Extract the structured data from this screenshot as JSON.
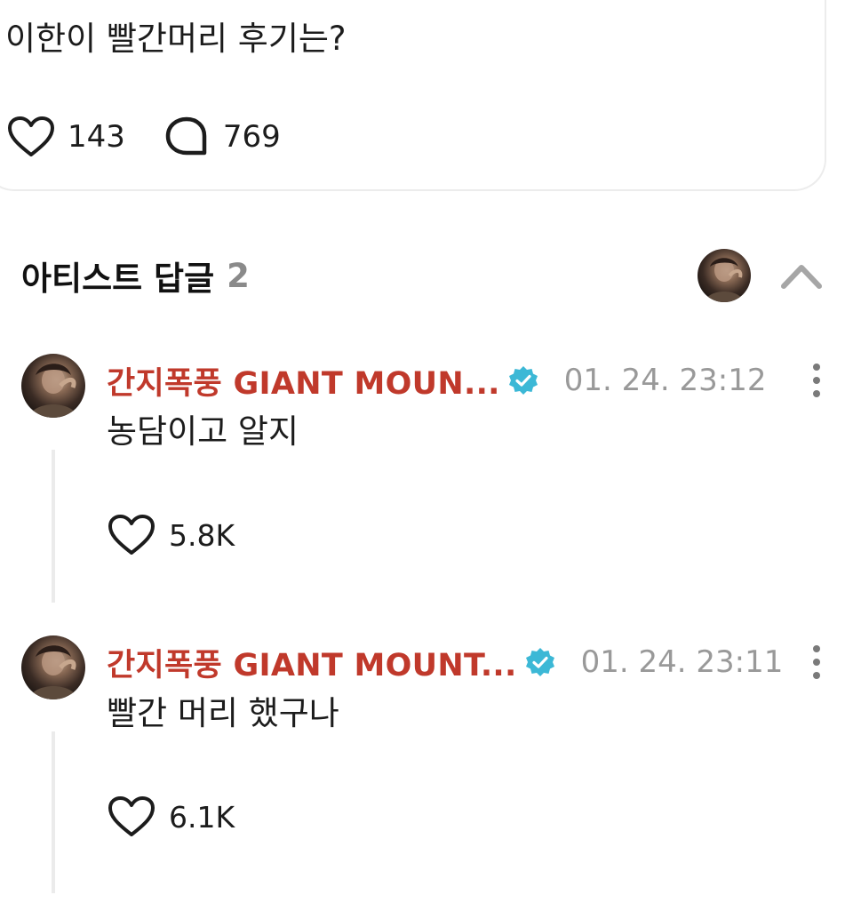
{
  "post": {
    "text": "이한이 빨간머리 후기는?",
    "likes": "143",
    "comments": "769"
  },
  "section": {
    "title": "아티스트 답글",
    "count": "2"
  },
  "replies": [
    {
      "author": "간지폭풍 GIANT MOUN...",
      "time": "01. 24. 23:12",
      "text": "농담이고 알지",
      "likes": "5.8K"
    },
    {
      "author": "간지폭풍 GIANT MOUNT...",
      "time": "01. 24. 23:11",
      "text": "빨간 머리 했구나",
      "likes": "6.1K"
    }
  ],
  "colors": {
    "author": "#c0392b",
    "verified": "#3cb8d6",
    "muted": "#999999"
  },
  "icons": {
    "like": "heart-icon",
    "comment": "speech-bubble-icon",
    "verified": "verified-badge-icon",
    "more": "more-vertical-icon",
    "collapse": "chevron-up-icon"
  }
}
